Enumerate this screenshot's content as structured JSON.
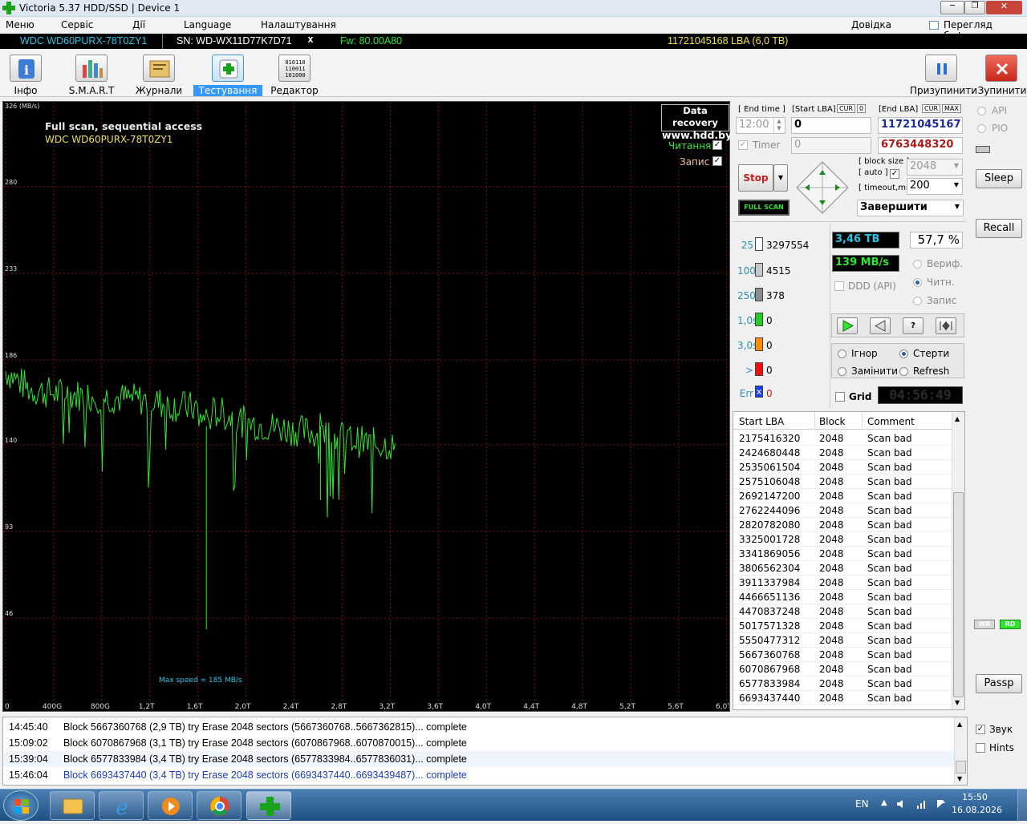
{
  "window": {
    "title": "Victoria 5.37 HDD/SSD | Device 1",
    "buttons": [
      "─",
      "❐",
      "✕"
    ]
  },
  "menu": {
    "items": [
      "Меню",
      "Сервіс",
      "Дії",
      "Language",
      "Налаштування"
    ],
    "help": "Довідка",
    "clipboard": "Перегляд буфера"
  },
  "device": {
    "model": "WDC WD60PURX-78T0ZY1",
    "serial": "SN: WD-WX11D77K7D71",
    "close": "x",
    "firmware": "Fw: 80.00A80",
    "capacity": "11721045168 LBA (6,0 TB)"
  },
  "toolbar": {
    "tabs": [
      {
        "label": "Інфо",
        "icon": "info-icon"
      },
      {
        "label": "S.M.A.R.T",
        "icon": "smart-icon"
      },
      {
        "label": "Журнали",
        "icon": "logs-icon"
      },
      {
        "label": "Тестування",
        "icon": "testing-icon"
      },
      {
        "label": "Редактор",
        "icon": "editor-icon"
      }
    ],
    "pause": "Призупинити",
    "stop": "Зупинити"
  },
  "graph": {
    "title": "Full scan, sequential access",
    "subtitle": "WDC WD60PURX-78T0ZY1",
    "badge_line1": "Data recovery",
    "badge_line2": "www.hdd.by",
    "read_label": "Читання",
    "write_label": "Запис",
    "max_speed": "Max speed = 185 MB/s",
    "y_unit": "326 (MB/s)",
    "y_ticks": [
      "280",
      "233",
      "186",
      "140",
      "93",
      "46"
    ],
    "x_ticks": [
      "0",
      "400G",
      "800G",
      "1,2T",
      "1,6T",
      "2,0T",
      "2,4T",
      "2,8T",
      "3,2T",
      "3,6T",
      "4,0T",
      "4,4T",
      "4,8T",
      "5,2T",
      "5,6T",
      "6,0T"
    ]
  },
  "chart_data": {
    "type": "line",
    "ylim": [
      0,
      326
    ],
    "ylabel": "(MB/s)",
    "series": [
      {
        "name": "Читання",
        "x_tb": [
          0.0,
          0.2,
          0.4,
          0.6,
          0.8,
          1.0,
          1.2,
          1.4,
          1.6,
          1.67,
          1.72,
          1.8,
          2.0,
          2.2,
          2.4,
          2.6,
          2.62,
          2.66,
          2.8,
          3.0,
          3.2,
          3.25
        ],
        "values": [
          180,
          170,
          168,
          167,
          166,
          165,
          164,
          161,
          160,
          40,
          158,
          157,
          152,
          150,
          148,
          146,
          110,
          146,
          144,
          141,
          140,
          138
        ]
      }
    ]
  },
  "ctrl": {
    "end_time_label": "[ End time ]",
    "start_lba_label": "[Start LBA]",
    "cur": "CUR",
    "zero": "0",
    "end_lba_label": "[End LBA]",
    "max": "MAX",
    "time": "12:00",
    "start_lba": "0",
    "end_lba": "11721045167",
    "timer": "Timer",
    "timer_value": "0",
    "current_lba": "6763448320",
    "block_size_label": "[ block size ]",
    "auto_label": "[ auto ]",
    "block_size": "2048",
    "timeout_label": "[ timeout,ms ]",
    "timeout": "200",
    "stop_btn": "Stop",
    "fullscan": "FULL SCAN",
    "finish": "Завершити",
    "processed": "3,46 TB",
    "percent": "57,7  %",
    "speed": "139 MB/s",
    "verify": "Вериф.",
    "read": "Читн.",
    "write": "Запис",
    "ddd": "DDD (API)",
    "ignore": "Ігнор",
    "erase": "Стерти",
    "replace": "Замінити",
    "refresh": "Refresh",
    "grid": "Grid",
    "clock": "04:56:49"
  },
  "histogram": [
    {
      "label": "25",
      "value": "3297554",
      "color": "#ffffff"
    },
    {
      "label": "100",
      "value": "4515",
      "color": "#c8c8c8"
    },
    {
      "label": "250",
      "value": "378",
      "color": "#8c8c8c"
    },
    {
      "label": "1,0s",
      "value": "0",
      "color": "#22cc22"
    },
    {
      "label": "3,0s",
      "value": "0",
      "color": "#ff8c00"
    },
    {
      "label": ">",
      "value": "0",
      "color": "#ee1111"
    },
    {
      "label": "Err",
      "value": "0",
      "color": "#1a3cff"
    }
  ],
  "table": {
    "headers": [
      "Start LBA",
      "Block",
      "Comment"
    ],
    "rows": [
      [
        "2175416320",
        "2048",
        "Scan bad"
      ],
      [
        "2424680448",
        "2048",
        "Scan bad"
      ],
      [
        "2535061504",
        "2048",
        "Scan bad"
      ],
      [
        "2575106048",
        "2048",
        "Scan bad"
      ],
      [
        "2692147200",
        "2048",
        "Scan bad"
      ],
      [
        "2762244096",
        "2048",
        "Scan bad"
      ],
      [
        "2820782080",
        "2048",
        "Scan bad"
      ],
      [
        "3325001728",
        "2048",
        "Scan bad"
      ],
      [
        "3341869056",
        "2048",
        "Scan bad"
      ],
      [
        "3806562304",
        "2048",
        "Scan bad"
      ],
      [
        "3911337984",
        "2048",
        "Scan bad"
      ],
      [
        "4466651136",
        "2048",
        "Scan bad"
      ],
      [
        "4470837248",
        "2048",
        "Scan bad"
      ],
      [
        "5017571328",
        "2048",
        "Scan bad"
      ],
      [
        "5550477312",
        "2048",
        "Scan bad"
      ],
      [
        "5667360768",
        "2048",
        "Scan bad"
      ],
      [
        "6070867968",
        "2048",
        "Scan bad"
      ],
      [
        "6577833984",
        "2048",
        "Scan bad"
      ],
      [
        "6693437440",
        "2048",
        "Scan bad"
      ]
    ]
  },
  "right": {
    "api": "API",
    "pio": "PIO",
    "sleep": "Sleep",
    "recall": "Recall",
    "wr": "WR",
    "rd": "RD",
    "passp": "Passp",
    "sound": "Звук",
    "hints": "Hints"
  },
  "log": [
    {
      "time": "14:45:40",
      "text": "Block 5667360768 (2,9 TB) try Erase 2048 sectors (5667360768..5667362815)... complete"
    },
    {
      "time": "15:09:02",
      "text": "Block 6070867968 (3,1 TB) try Erase 2048 sectors (6070867968..6070870015)... complete"
    },
    {
      "time": "15:39:04",
      "text": "Block 6577833984 (3,4 TB) try Erase 2048 sectors (6577833984..6577836031)... complete"
    },
    {
      "time": "15:46:04",
      "text": "Block 6693437440 (3,4 TB) try Erase 2048 sectors (6693437440..6693439487)... complete"
    }
  ],
  "taskbar": {
    "lang": "EN",
    "time": "15:50",
    "date": "16.08.2026"
  }
}
